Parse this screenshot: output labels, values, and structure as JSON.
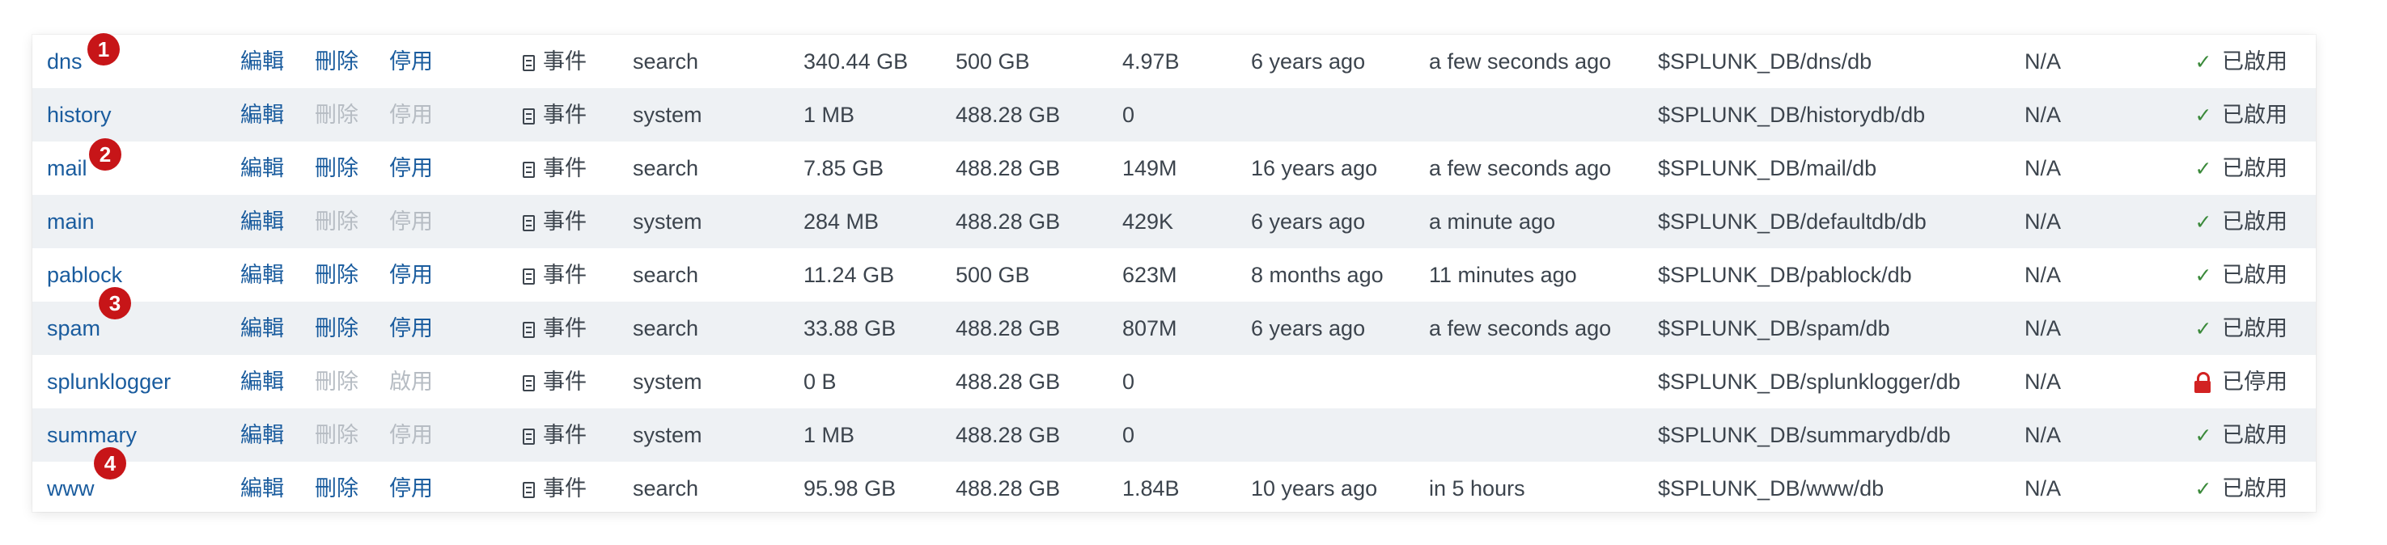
{
  "colors": {
    "link": "#1a5c9e",
    "disabled_text": "#b6bcc3",
    "alternate_row": "#eef1f4",
    "enabled_check": "#3b8a3b",
    "lock": "#d22222",
    "badge": "#c71518"
  },
  "icons": {
    "events": "document-icon",
    "enabled": "checkmark-icon",
    "disabled": "lock-icon"
  },
  "rows": [
    {
      "name": "dns",
      "edit": "編輯",
      "delete": "刪除",
      "toggle": "停用",
      "events": "事件",
      "app": "search",
      "current_size": "340.44 GB",
      "max_size": "500 GB",
      "event_count": "4.97B",
      "earliest_event": "6 years ago",
      "latest_event": "a few seconds ago",
      "home_path": "$SPLUNK_DB/dns/db",
      "frozen_path": "N/A",
      "status": "已啟用",
      "badge": "1"
    },
    {
      "name": "history",
      "edit": "編輯",
      "delete": "刪除",
      "toggle": "停用",
      "events": "事件",
      "app": "system",
      "current_size": "1 MB",
      "max_size": "488.28 GB",
      "event_count": "0",
      "earliest_event": "",
      "latest_event": "",
      "home_path": "$SPLUNK_DB/historydb/db",
      "frozen_path": "N/A",
      "status": "已啟用",
      "badge": ""
    },
    {
      "name": "mail",
      "edit": "編輯",
      "delete": "刪除",
      "toggle": "停用",
      "events": "事件",
      "app": "search",
      "current_size": "7.85 GB",
      "max_size": "488.28 GB",
      "event_count": "149M",
      "earliest_event": "16 years ago",
      "latest_event": "a few seconds ago",
      "home_path": "$SPLUNK_DB/mail/db",
      "frozen_path": "N/A",
      "status": "已啟用",
      "badge": "2"
    },
    {
      "name": "main",
      "edit": "編輯",
      "delete": "刪除",
      "toggle": "停用",
      "events": "事件",
      "app": "system",
      "current_size": "284 MB",
      "max_size": "488.28 GB",
      "event_count": "429K",
      "earliest_event": "6 years ago",
      "latest_event": "a minute ago",
      "home_path": "$SPLUNK_DB/defaultdb/db",
      "frozen_path": "N/A",
      "status": "已啟用",
      "badge": ""
    },
    {
      "name": "pablock",
      "edit": "編輯",
      "delete": "刪除",
      "toggle": "停用",
      "events": "事件",
      "app": "search",
      "current_size": "11.24 GB",
      "max_size": "500 GB",
      "event_count": "623M",
      "earliest_event": "8 months ago",
      "latest_event": "11 minutes ago",
      "home_path": "$SPLUNK_DB/pablock/db",
      "frozen_path": "N/A",
      "status": "已啟用",
      "badge": ""
    },
    {
      "name": "spam",
      "edit": "編輯",
      "delete": "刪除",
      "toggle": "停用",
      "events": "事件",
      "app": "search",
      "current_size": "33.88 GB",
      "max_size": "488.28 GB",
      "event_count": "807M",
      "earliest_event": "6 years ago",
      "latest_event": "a few seconds ago",
      "home_path": "$SPLUNK_DB/spam/db",
      "frozen_path": "N/A",
      "status": "已啟用",
      "badge": "3"
    },
    {
      "name": "splunklogger",
      "edit": "編輯",
      "delete": "刪除",
      "toggle": "啟用",
      "events": "事件",
      "app": "system",
      "current_size": "0 B",
      "max_size": "488.28 GB",
      "event_count": "0",
      "earliest_event": "",
      "latest_event": "",
      "home_path": "$SPLUNK_DB/splunklogger/db",
      "frozen_path": "N/A",
      "status": "已停用",
      "badge": ""
    },
    {
      "name": "summary",
      "edit": "編輯",
      "delete": "刪除",
      "toggle": "停用",
      "events": "事件",
      "app": "system",
      "current_size": "1 MB",
      "max_size": "488.28 GB",
      "event_count": "0",
      "earliest_event": "",
      "latest_event": "",
      "home_path": "$SPLUNK_DB/summarydb/db",
      "frozen_path": "N/A",
      "status": "已啟用",
      "badge": ""
    },
    {
      "name": "www",
      "edit": "編輯",
      "delete": "刪除",
      "toggle": "停用",
      "events": "事件",
      "app": "search",
      "current_size": "95.98 GB",
      "max_size": "488.28 GB",
      "event_count": "1.84B",
      "earliest_event": "10 years ago",
      "latest_event": "in 5 hours",
      "home_path": "$SPLUNK_DB/www/db",
      "frozen_path": "N/A",
      "status": "已啟用",
      "badge": "4"
    }
  ]
}
